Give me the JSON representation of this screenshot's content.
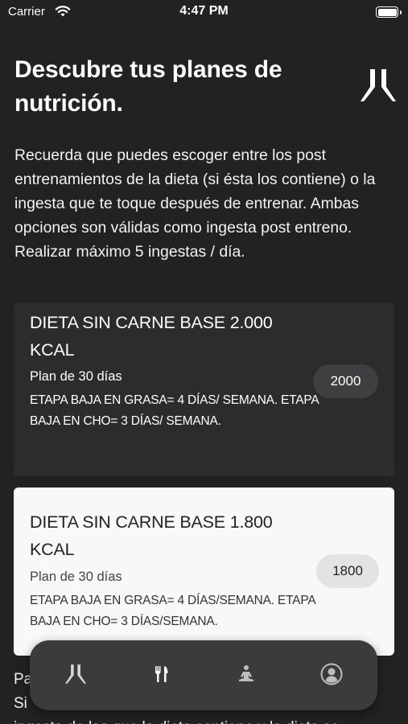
{
  "status_bar": {
    "carrier": "Carrier",
    "time": "4:47 PM"
  },
  "header": {
    "title": "Descubre tus planes de nutrición."
  },
  "intro": "Recuerda que puedes escoger entre los post entrenamientos de la dieta (si ésta los contiene) o la ingesta que te toque después de entrenar. Ambas opciones son válidas como ingesta post entreno. Realizar máximo 5 ingestas / día.",
  "plans": [
    {
      "title": "DIETA SIN CARNE BASE 2.000 KCAL",
      "subtitle": "Plan de 30 días",
      "description": "ETAPA BAJA EN GRASA= 4 DÍAS/ SEMANA. ETAPA BAJA EN CHO= 3 DÍAS/ SEMANA.",
      "kcal": "2000",
      "selected": false
    },
    {
      "title": "DIETA SIN CARNE BASE 1.800 KCAL",
      "subtitle": "Plan de 30 días",
      "description": "ETAPA BAJA EN GRASA= 4 DÍAS/SEMANA. ETAPA BAJA EN CHO= 3 DÍAS/SEMANA.",
      "kcal": "1800",
      "selected": true
    }
  ],
  "bottom_text_lines": [
    "Pa",
    "Si",
    "ingesta de las que la dieta contiene y la dieta se"
  ],
  "tab_bar": {
    "items": [
      {
        "icon": "logo-icon"
      },
      {
        "icon": "fork-knife-icon"
      },
      {
        "icon": "meditation-icon"
      },
      {
        "icon": "profile-icon"
      }
    ]
  },
  "colors": {
    "background": "#222223",
    "card_dark": "#2c2c2d",
    "card_light": "#f8f8f8",
    "tab_bar": "#3b3b3d"
  }
}
